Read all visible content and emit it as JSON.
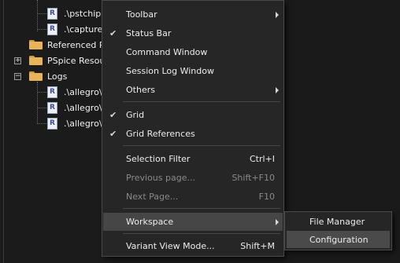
{
  "tree": {
    "items": [
      {
        "label": ".\\pstchip.d",
        "icon": "R"
      },
      {
        "label": ".\\capture",
        "icon": "R"
      },
      {
        "label": "Referenced P",
        "icon": "folder-icon"
      },
      {
        "label": "PSpice Resou",
        "icon": "folder-icon"
      },
      {
        "label": "Logs",
        "icon": "folder-icon"
      },
      {
        "label": ".\\allegro\\",
        "icon": "R"
      },
      {
        "label": ".\\allegro\\",
        "icon": "R"
      },
      {
        "label": ".\\allegro\\",
        "icon": "R"
      }
    ],
    "expanders": {
      "pspice": "+",
      "logs": "−"
    },
    "file_icon_letter": "R"
  },
  "menu": {
    "items": [
      {
        "label": "Toolbar",
        "checked": false,
        "shortcut": "",
        "submenu": true,
        "disabled": false
      },
      {
        "label": "Status Bar",
        "checked": true,
        "shortcut": "",
        "submenu": false,
        "disabled": false
      },
      {
        "label": "Command Window",
        "checked": false,
        "shortcut": "",
        "submenu": false,
        "disabled": false
      },
      {
        "label": "Session Log Window",
        "checked": false,
        "shortcut": "",
        "submenu": false,
        "disabled": false
      },
      {
        "label": "Others",
        "checked": false,
        "shortcut": "",
        "submenu": true,
        "disabled": false
      },
      {
        "label": "Grid",
        "checked": true,
        "shortcut": "",
        "submenu": false,
        "disabled": false
      },
      {
        "label": "Grid References",
        "checked": true,
        "shortcut": "",
        "submenu": false,
        "disabled": false
      },
      {
        "label": "Selection Filter",
        "checked": false,
        "shortcut": "Ctrl+I",
        "submenu": false,
        "disabled": false
      },
      {
        "label": "Previous page...",
        "checked": false,
        "shortcut": "Shift+F10",
        "submenu": false,
        "disabled": true
      },
      {
        "label": "Next Page...",
        "checked": false,
        "shortcut": "F10",
        "submenu": false,
        "disabled": true
      },
      {
        "label": "Workspace",
        "checked": false,
        "shortcut": "",
        "submenu": true,
        "disabled": false,
        "highlighted": true
      },
      {
        "label": "Variant View Mode...",
        "checked": false,
        "shortcut": "Shift+M",
        "submenu": false,
        "disabled": false
      }
    ],
    "check_glyph": "✔"
  },
  "submenu": {
    "items": [
      {
        "label": "File Manager",
        "highlighted": false
      },
      {
        "label": "Configuration",
        "highlighted": true
      }
    ]
  },
  "colors": {
    "background": "#1a1a1a",
    "menu_bg": "#262626",
    "highlight": "#464646",
    "disabled_text": "#8a8a8a",
    "folder": "#e7b45a"
  }
}
